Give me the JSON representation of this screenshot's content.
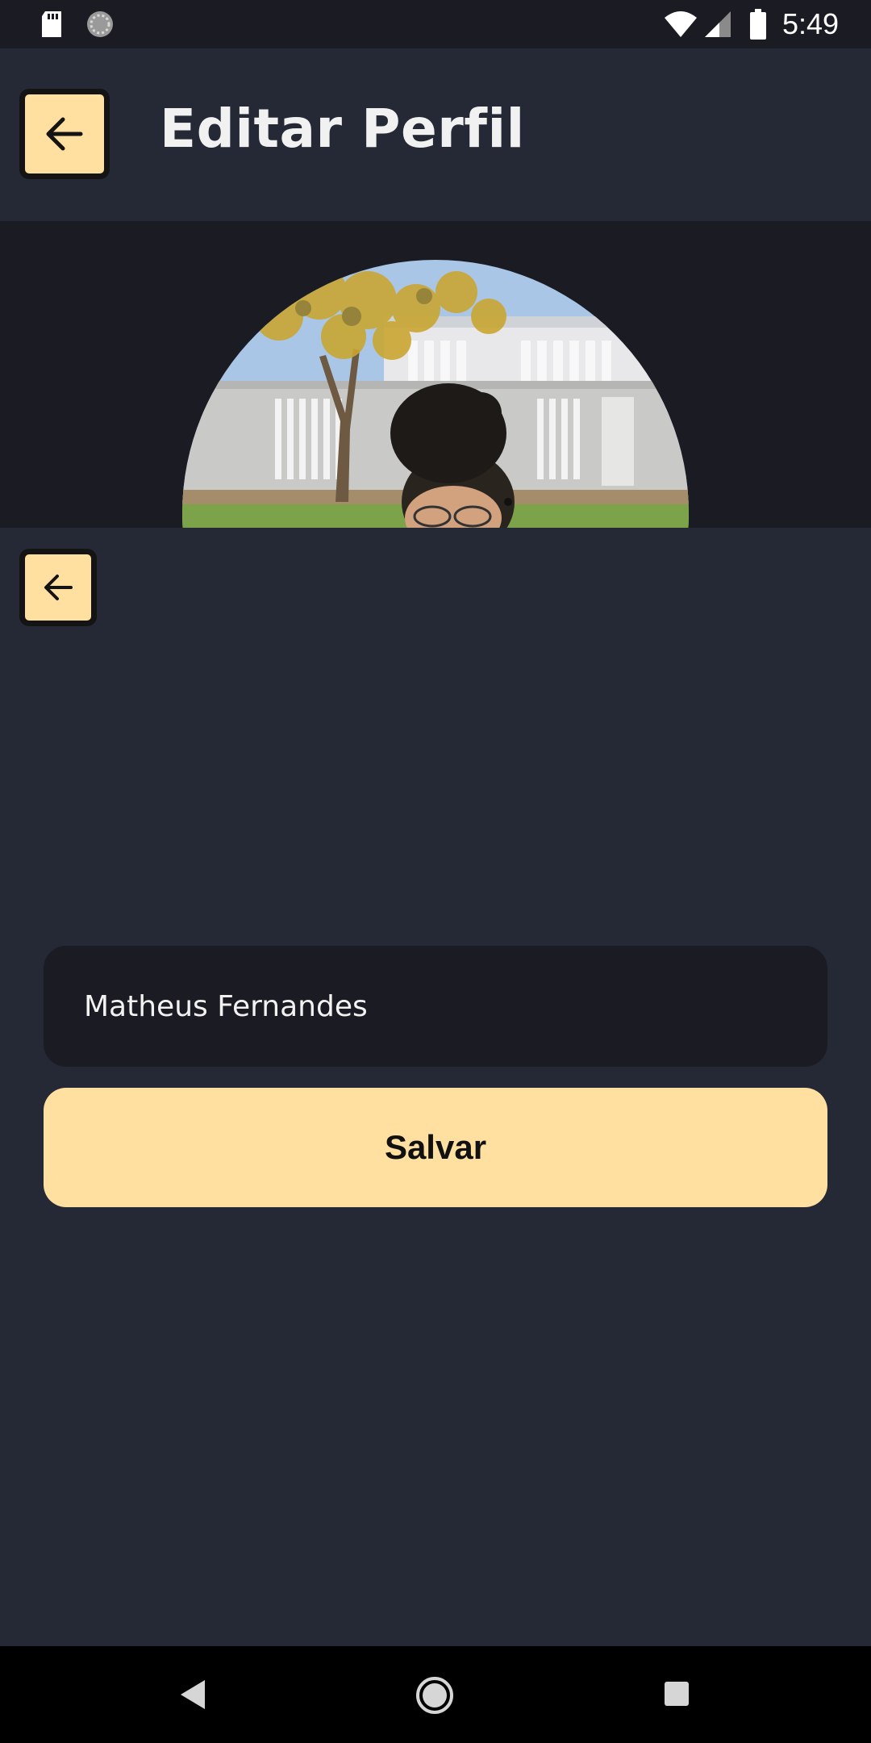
{
  "status_bar": {
    "time": "5:49",
    "icons": [
      "sd-card-icon",
      "sync-icon",
      "wifi-icon",
      "signal-icon",
      "battery-icon"
    ]
  },
  "header": {
    "title": "Editar Perfil",
    "back_icon": "arrow-left-icon"
  },
  "profile": {
    "photo": "profile-photo"
  },
  "form": {
    "name_value": "Matheus Fernandes",
    "save_label": "Salvar"
  },
  "colors": {
    "background": "#252935",
    "surface": "#1b1c23",
    "accent": "#ffe0a0",
    "text": "#f1f1f1"
  },
  "nav_bar": {
    "icons": [
      "nav-back-icon",
      "nav-home-icon",
      "nav-recents-icon"
    ]
  }
}
